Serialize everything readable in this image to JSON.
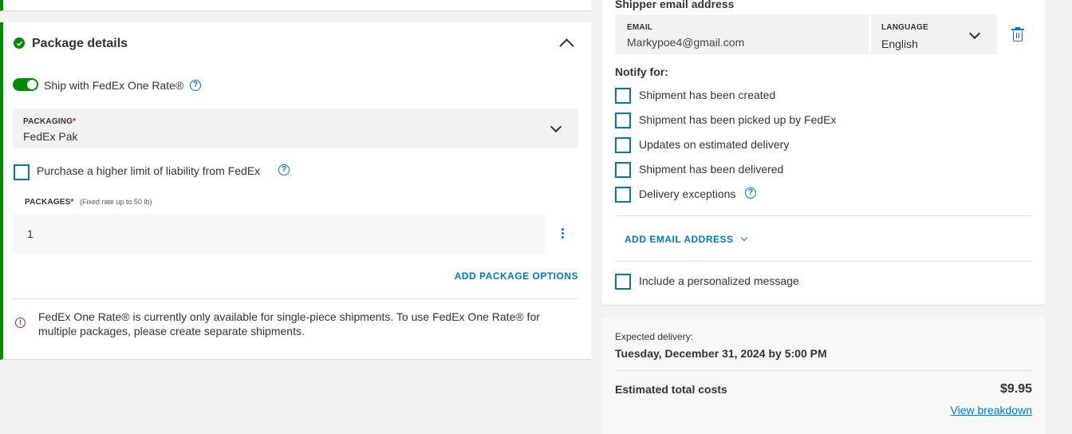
{
  "package_details": {
    "title": "Package details",
    "one_rate_toggle_label": "Ship with FedEx One Rate®",
    "packaging": {
      "label": "PACKAGING",
      "required_mark": "*",
      "value": "FedEx Pak"
    },
    "liability_label": "Purchase a higher limit of liability from FedEx",
    "packages": {
      "label": "PACKAGES",
      "required_mark": "*",
      "hint": "(Fixed rate up to 50 lb)",
      "value": "1"
    },
    "add_package_options": "ADD PACKAGE OPTIONS",
    "info_message": "FedEx One Rate® is currently only available for single-piece shipments. To use FedEx One Rate® for multiple packages, please create separate shipments."
  },
  "shipper_email": {
    "title": "Shipper email address",
    "email_label": "EMAIL",
    "email_value": "Markypoe4@gmail.com",
    "language_label": "LANGUAGE",
    "language_value": "English",
    "notify_title": "Notify for:",
    "notify_options": [
      "Shipment has been created",
      "Shipment has been picked up by FedEx",
      "Updates on estimated delivery",
      "Shipment has been delivered",
      "Delivery exceptions"
    ],
    "add_email": "ADD EMAIL ADDRESS",
    "personal_message": "Include a personalized message"
  },
  "summary": {
    "expected_label": "Expected delivery:",
    "expected_value": "Tuesday, December 31, 2024 by 5:00 PM",
    "total_label": "Estimated total costs",
    "total_value": "$9.95",
    "breakdown_link": "View breakdown"
  },
  "colors": {
    "accent_green": "#008a00",
    "link_blue": "#007ab7",
    "required_red": "#de002e",
    "info_purple": "#6b2c91"
  }
}
